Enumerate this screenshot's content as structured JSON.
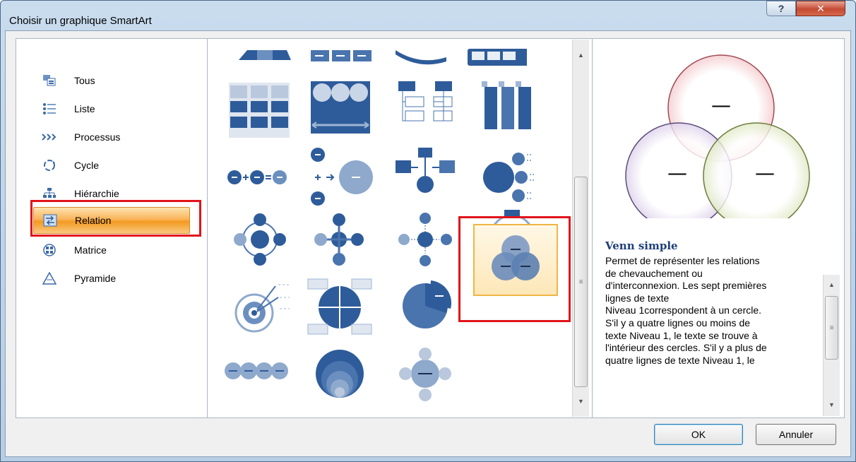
{
  "window": {
    "title": "Choisir un graphique SmartArt",
    "help_label": "?",
    "close_label": "✕"
  },
  "categories": [
    {
      "label": "Tous",
      "icon": "all-icon"
    },
    {
      "label": "Liste",
      "icon": "list-icon"
    },
    {
      "label": "Processus",
      "icon": "process-icon"
    },
    {
      "label": "Cycle",
      "icon": "cycle-icon"
    },
    {
      "label": "Hiérarchie",
      "icon": "hierarchy-icon"
    },
    {
      "label": "Relation",
      "icon": "relation-icon",
      "selected": true
    },
    {
      "label": "Matrice",
      "icon": "matrix-icon"
    },
    {
      "label": "Pyramide",
      "icon": "pyramid-icon"
    }
  ],
  "preview": {
    "title": "Venn simple",
    "description": "Permet de représenter les relations\nde chevauchement ou\nd'interconnexion. Les sept premières\nlignes de texte\nNiveau 1correspondent à un cercle.\nS'il y a quatre lignes ou moins de\ntexte Niveau 1, le texte se trouve à\nl'intérieur des cercles. S'il y a plus de\nquatre lignes de texte Niveau 1, le",
    "circle_label": "—"
  },
  "buttons": {
    "ok": "OK",
    "cancel": "Annuler"
  },
  "colors": {
    "accent_blue": "#2e5c9a",
    "selection_orange": "#f39a22",
    "highlight_red": "#e1141a"
  }
}
